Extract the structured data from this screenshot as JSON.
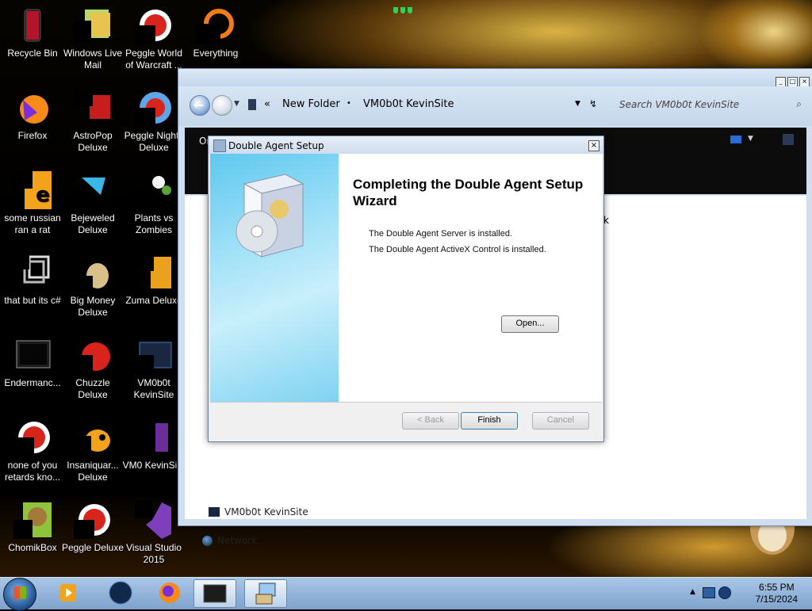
{
  "desktop": {
    "icons": [
      {
        "label": "Recycle Bin",
        "icon": "recycle-bin-icon"
      },
      {
        "label": "Windows Live Mail",
        "icon": "mail-icon"
      },
      {
        "label": "Peggle World of Warcraft ...",
        "icon": "peggle-icon"
      },
      {
        "label": "Everything",
        "icon": "search-tool-icon"
      },
      {
        "label": "Firefox",
        "icon": "firefox-icon"
      },
      {
        "label": "AstroPop Deluxe",
        "icon": "astropop-icon"
      },
      {
        "label": "Peggle Nights Deluxe",
        "icon": "peggle-icon"
      },
      {
        "label": "some russian ran a rat",
        "icon": "app-icon"
      },
      {
        "label": "Bejeweled Deluxe",
        "icon": "bejeweled-icon"
      },
      {
        "label": "Plants vs Zombies",
        "icon": "plants-vs-zombies-icon"
      },
      {
        "label": "that but its c#",
        "icon": "shortcut-icon"
      },
      {
        "label": "Big Money Deluxe",
        "icon": "big-money-icon"
      },
      {
        "label": "Zuma Deluxe",
        "icon": "zuma-icon"
      },
      {
        "label": "Endermanc...",
        "icon": "app-icon"
      },
      {
        "label": "Chuzzle Deluxe",
        "icon": "chuzzle-icon"
      },
      {
        "label": "VM0b0t KevinSite",
        "icon": "folder-icon"
      },
      {
        "label": "none of you retards kno...",
        "icon": "app-icon"
      },
      {
        "label": "Insaniquar... Deluxe",
        "icon": "fish-icon"
      },
      {
        "label": "VM0 KevinSi...",
        "icon": "app-icon"
      },
      {
        "label": "ChomikBox",
        "icon": "hamster-icon"
      },
      {
        "label": "Peggle Deluxe",
        "icon": "peggle-icon"
      },
      {
        "label": "Visual Studio 2015",
        "icon": "visual-studio-icon"
      }
    ]
  },
  "explorer": {
    "breadcrumb_sep": "«",
    "crumb1": "New Folder",
    "crumb_sep": "•",
    "crumb2": "VM0b0t KevinSite",
    "search_placeholder": "Search VM0b0t KevinSite",
    "toolbar_partial": "Or",
    "pane_partial": "k",
    "pane_items": [
      "VM0b0t KevinSite",
      "Network"
    ]
  },
  "dialog": {
    "title": "Double Agent Setup",
    "close": "×",
    "heading": "Completing the Double Agent Setup Wizard",
    "messages": [
      "The Double Agent Server is installed.",
      "The Double Agent ActiveX Control is installed."
    ],
    "open_button": "Open...",
    "back_button": "< Back",
    "finish_button": "Finish",
    "cancel_button": "Cancel"
  },
  "taskbar": {
    "items": [
      "media-player-icon",
      "globe-app-icon",
      "firefox-icon",
      "app-window-icon",
      "setup-icon"
    ],
    "time": "6:55 PM",
    "date": "7/15/2024"
  }
}
